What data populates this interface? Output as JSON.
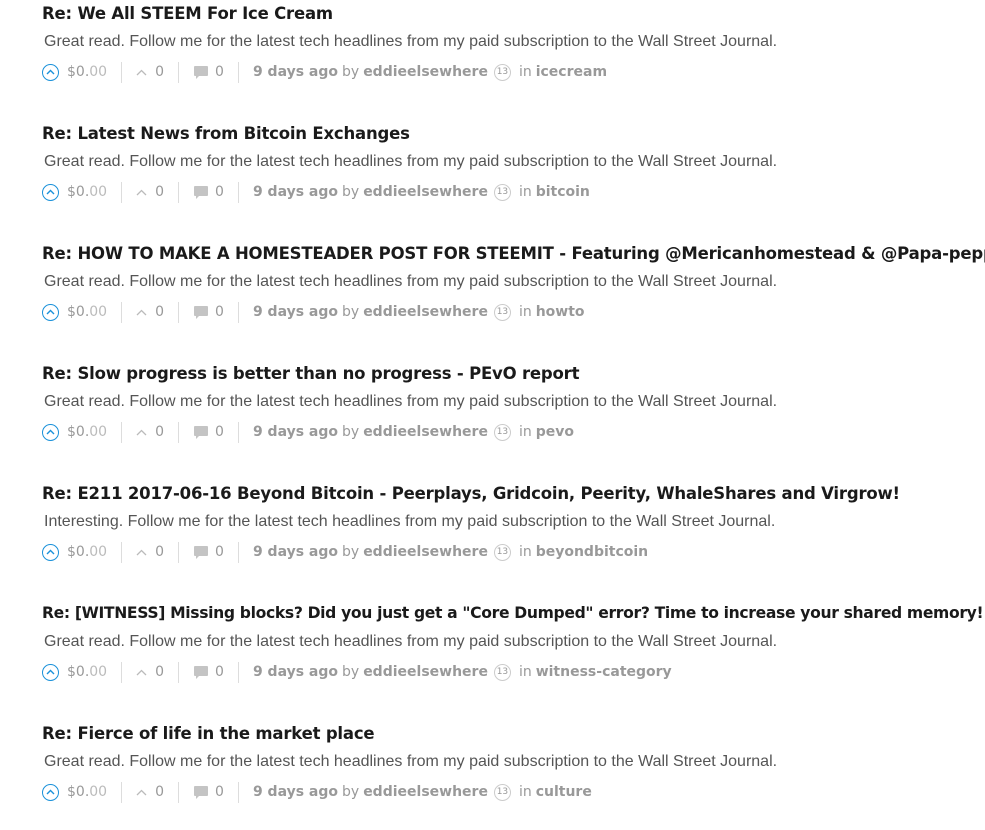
{
  "colors": {
    "title": "#1a1a1a",
    "body": "#555555",
    "meta": "#999999",
    "vote_accent": "#1a91da",
    "separator": "#dddddd"
  },
  "posts": [
    {
      "title": "Re: We All STEEM For Ice Cream",
      "body": "Great read. Follow me for the latest tech headlines from my paid subscription to the Wall Street Journal.",
      "payout_dollars": "$0.",
      "payout_cents": "00",
      "votes": "0",
      "replies": "0",
      "age": "9 days ago",
      "by": "by",
      "author": "eddieelsewhere",
      "reputation": "13",
      "in": "in",
      "category": "icecream"
    },
    {
      "title": "Re: Latest News from Bitcoin Exchanges",
      "body": "Great read. Follow me for the latest tech headlines from my paid subscription to the Wall Street Journal.",
      "payout_dollars": "$0.",
      "payout_cents": "00",
      "votes": "0",
      "replies": "0",
      "age": "9 days ago",
      "by": "by",
      "author": "eddieelsewhere",
      "reputation": "13",
      "in": "in",
      "category": "bitcoin"
    },
    {
      "title": "Re: HOW TO MAKE A HOMESTEADER POST FOR STEEMIT - Featuring @Mericanhomestead & @Papa-pepper",
      "body": "Great read. Follow me for the latest tech headlines from my paid subscription to the Wall Street Journal.",
      "payout_dollars": "$0.",
      "payout_cents": "00",
      "votes": "0",
      "replies": "0",
      "age": "9 days ago",
      "by": "by",
      "author": "eddieelsewhere",
      "reputation": "13",
      "in": "in",
      "category": "howto"
    },
    {
      "title": "Re: Slow progress is better than no progress - PEvO report",
      "body": "Great read. Follow me for the latest tech headlines from my paid subscription to the Wall Street Journal.",
      "payout_dollars": "$0.",
      "payout_cents": "00",
      "votes": "0",
      "replies": "0",
      "age": "9 days ago",
      "by": "by",
      "author": "eddieelsewhere",
      "reputation": "13",
      "in": "in",
      "category": "pevo"
    },
    {
      "title": "Re: E211 2017-06-16 Beyond Bitcoin - Peerplays, Gridcoin, Peerity, WhaleShares and Virgrow!",
      "body": "Interesting. Follow me for the latest tech headlines from my paid subscription to the Wall Street Journal.",
      "payout_dollars": "$0.",
      "payout_cents": "00",
      "votes": "0",
      "replies": "0",
      "age": "9 days ago",
      "by": "by",
      "author": "eddieelsewhere",
      "reputation": "13",
      "in": "in",
      "category": "beyondbitcoin"
    },
    {
      "title": "Re: [WITNESS] Missing blocks? Did you just get a \"Core Dumped\" error? Time to increase your shared memory!",
      "body": "Great read. Follow me for the latest tech headlines from my paid subscription to the Wall Street Journal.",
      "payout_dollars": "$0.",
      "payout_cents": "00",
      "votes": "0",
      "replies": "0",
      "age": "9 days ago",
      "by": "by",
      "author": "eddieelsewhere",
      "reputation": "13",
      "in": "in",
      "category": "witness-category"
    },
    {
      "title": "Re: Fierce of life in the market place",
      "body": "Great read. Follow me for the latest tech headlines from my paid subscription to the Wall Street Journal.",
      "payout_dollars": "$0.",
      "payout_cents": "00",
      "votes": "0",
      "replies": "0",
      "age": "9 days ago",
      "by": "by",
      "author": "eddieelsewhere",
      "reputation": "13",
      "in": "in",
      "category": "culture"
    }
  ]
}
